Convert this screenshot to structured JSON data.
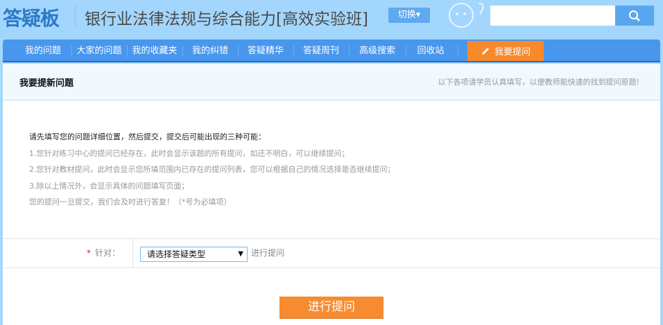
{
  "header": {
    "logo": "答疑板",
    "title": "银行业法律法规与综合能力[高效实验班]",
    "switch_label": "切换▾",
    "search_value": ""
  },
  "nav": {
    "items": [
      "我的问题",
      "大家的问题",
      "我的收藏夹",
      "我的纠错",
      "答疑精华",
      "答疑周刊",
      "高级搜索",
      "回收站"
    ],
    "ask_label": "我要提问"
  },
  "section": {
    "title": "我要提新问题",
    "hint": "以下各项请学员认真填写，以便教师能快速的找到提问原题!"
  },
  "intro": [
    "请先填写您的问题详细位置，然后提交，提交后可能出现的三种可能：",
    "1.您针对练习中心的提问已经存在，此时会显示该题的所有提问，如还不明白，可以继续提问；",
    "2.您针对教材提问，此时会显示您所填范围内已存在的提问列表，您可以根据自己的情况选择是否继续提问；",
    "3.除以上情况外，会显示具体的问题填写页面；",
    "您的提问一旦提交，我们会及时进行答复！（*号为必填项）"
  ],
  "form": {
    "required_mark": "*",
    "label": "针对：",
    "select_value": "请选择答疑类型",
    "after": "进行提问"
  },
  "submit_label": "进行提问",
  "colors": {
    "accent": "#f68b2f",
    "nav": "#4896ee"
  }
}
